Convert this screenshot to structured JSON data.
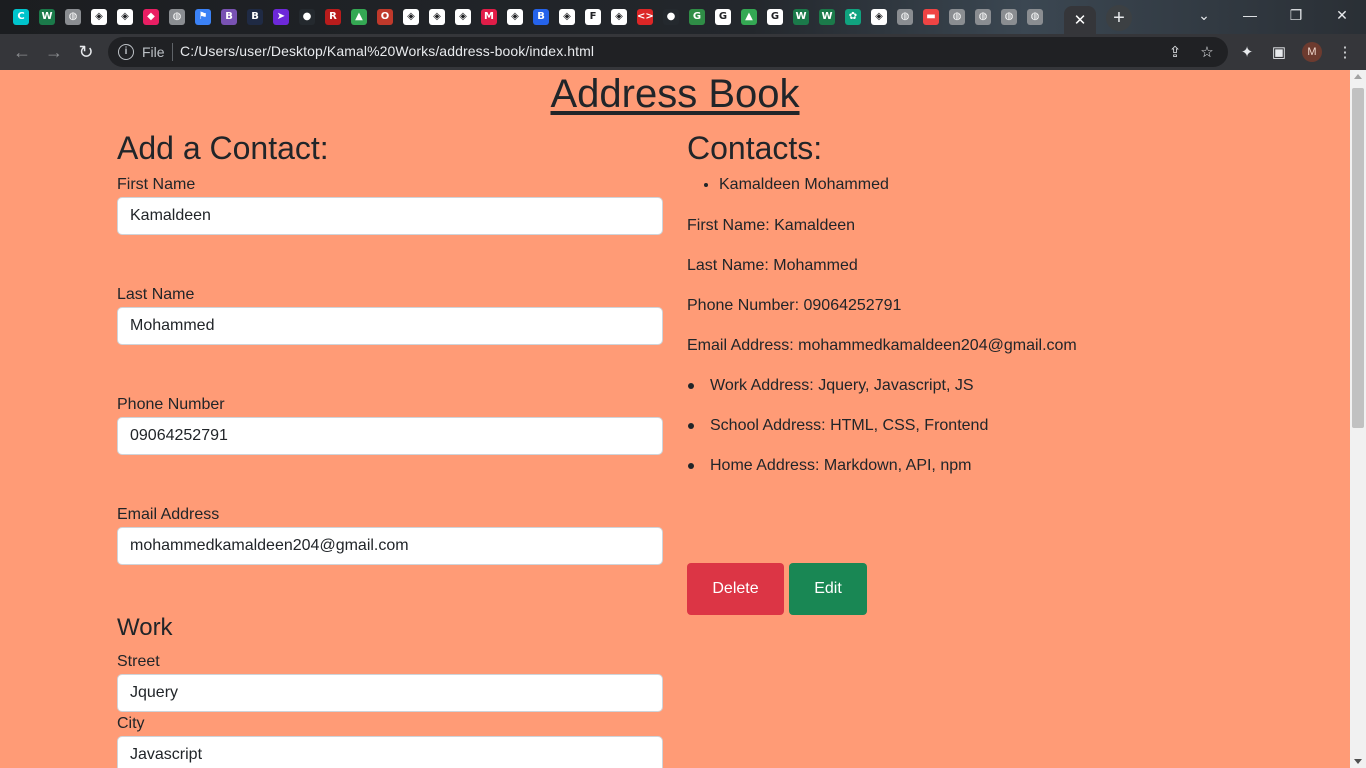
{
  "browser": {
    "tab_icons": [
      {
        "name": "canva-icon",
        "color": "#00c4cc",
        "glyph": "C"
      },
      {
        "name": "webflow-w-icon",
        "color": "#1b7a4a",
        "glyph": "W"
      },
      {
        "name": "globe-icon",
        "color": "#8a8d91",
        "glyph": "◍"
      },
      {
        "name": "codepen-icon",
        "color": "#ffffff",
        "glyph": "◈"
      },
      {
        "name": "codepen-icon",
        "color": "#ffffff",
        "glyph": "◈"
      },
      {
        "name": "cube-icon",
        "color": "#e91e63",
        "glyph": "◆"
      },
      {
        "name": "globe-icon",
        "color": "#8a8d91",
        "glyph": "◍"
      },
      {
        "name": "flag-icon",
        "color": "#3b82f6",
        "glyph": "⚑"
      },
      {
        "name": "bootstrap-icon",
        "color": "#7952b3",
        "glyph": "B"
      },
      {
        "name": "bootstrap-small-icon",
        "color": "#1f2a44",
        "glyph": "B"
      },
      {
        "name": "arrow-app-icon",
        "color": "#6d28d9",
        "glyph": "➤"
      },
      {
        "name": "github-icon",
        "color": "#24292e",
        "glyph": "●"
      },
      {
        "name": "ro-icon",
        "color": "#b91c1c",
        "glyph": "R"
      },
      {
        "name": "google-drive-icon",
        "color": "#34a853",
        "glyph": "▲"
      },
      {
        "name": "opera-icon",
        "color": "#c0392b",
        "glyph": "O"
      },
      {
        "name": "codepen-icon",
        "color": "#ffffff",
        "glyph": "◈"
      },
      {
        "name": "codepen-icon",
        "color": "#ffffff",
        "glyph": "◈"
      },
      {
        "name": "codepen-icon",
        "color": "#ffffff",
        "glyph": "◈"
      },
      {
        "name": "medium-m-icon",
        "color": "#e11d48",
        "glyph": "M"
      },
      {
        "name": "codepen-icon",
        "color": "#ffffff",
        "glyph": "◈"
      },
      {
        "name": "bootstrap-b-icon",
        "color": "#2563eb",
        "glyph": "B"
      },
      {
        "name": "codepen-icon",
        "color": "#ffffff",
        "glyph": "◈"
      },
      {
        "name": "f-icon",
        "color": "#ffffff",
        "glyph": "F"
      },
      {
        "name": "codepen-icon",
        "color": "#ffffff",
        "glyph": "◈"
      },
      {
        "name": "code-icon",
        "color": "#dc2626",
        "glyph": "<>"
      },
      {
        "name": "github-icon",
        "color": "#24292e",
        "glyph": "●"
      },
      {
        "name": "geeks-icon",
        "color": "#2f8d46",
        "glyph": "G"
      },
      {
        "name": "google-icon",
        "color": "#ffffff",
        "glyph": "G"
      },
      {
        "name": "google-drive-icon",
        "color": "#34a853",
        "glyph": "▲"
      },
      {
        "name": "google-icon",
        "color": "#ffffff",
        "glyph": "G"
      },
      {
        "name": "webflow-w-icon",
        "color": "#1b7a4a",
        "glyph": "W"
      },
      {
        "name": "webflow-w-icon",
        "color": "#1b7a4a",
        "glyph": "W"
      },
      {
        "name": "chatgpt-icon",
        "color": "#10a37f",
        "glyph": "✿"
      },
      {
        "name": "codepen-icon",
        "color": "#ffffff",
        "glyph": "◈"
      },
      {
        "name": "globe-icon",
        "color": "#8a8d91",
        "glyph": "◍"
      },
      {
        "name": "red-bar-icon",
        "color": "#ef4444",
        "glyph": "▬"
      },
      {
        "name": "globe-icon",
        "color": "#8a8d91",
        "glyph": "◍"
      },
      {
        "name": "globe-icon",
        "color": "#8a8d91",
        "glyph": "◍"
      },
      {
        "name": "globe-icon",
        "color": "#8a8d91",
        "glyph": "◍"
      },
      {
        "name": "globe-icon",
        "color": "#8a8d91",
        "glyph": "◍"
      }
    ],
    "address_file": "File",
    "address_url": "C:/Users/user/Desktop/Kamal%20Works/address-book/index.html",
    "avatar_letter": "M"
  },
  "page": {
    "title": "Address Book",
    "form": {
      "heading": "Add a Contact:",
      "first_name_label": "First Name",
      "first_name_value": "Kamaldeen",
      "last_name_label": "Last Name",
      "last_name_value": "Mohammed",
      "phone_label": "Phone Number",
      "phone_value": "09064252791",
      "email_label": "Email Address",
      "email_value": "mohammedkamaldeen204@gmail.com",
      "work_heading": "Work",
      "street_label": "Street",
      "street_value": "Jquery",
      "city_label": "City",
      "city_value": "Javascript"
    },
    "contacts": {
      "heading": "Contacts:",
      "list": [
        "Kamaldeen Mohammed"
      ],
      "first_name_line": "First Name: Kamaldeen",
      "last_name_line": "Last Name: Mohammed",
      "phone_line": "Phone Number: 09064252791",
      "email_line": "Email Address: mohammedkamaldeen204@gmail.com",
      "addresses": [
        "Work Address: Jquery, Javascript, JS",
        "School Address: HTML, CSS, Frontend",
        "Home Address: Markdown, API, npm"
      ],
      "delete_label": "Delete",
      "edit_label": "Edit"
    }
  },
  "colors": {
    "page_background": "#ff9b76",
    "delete_button": "#dc3545",
    "edit_button": "#198754"
  }
}
